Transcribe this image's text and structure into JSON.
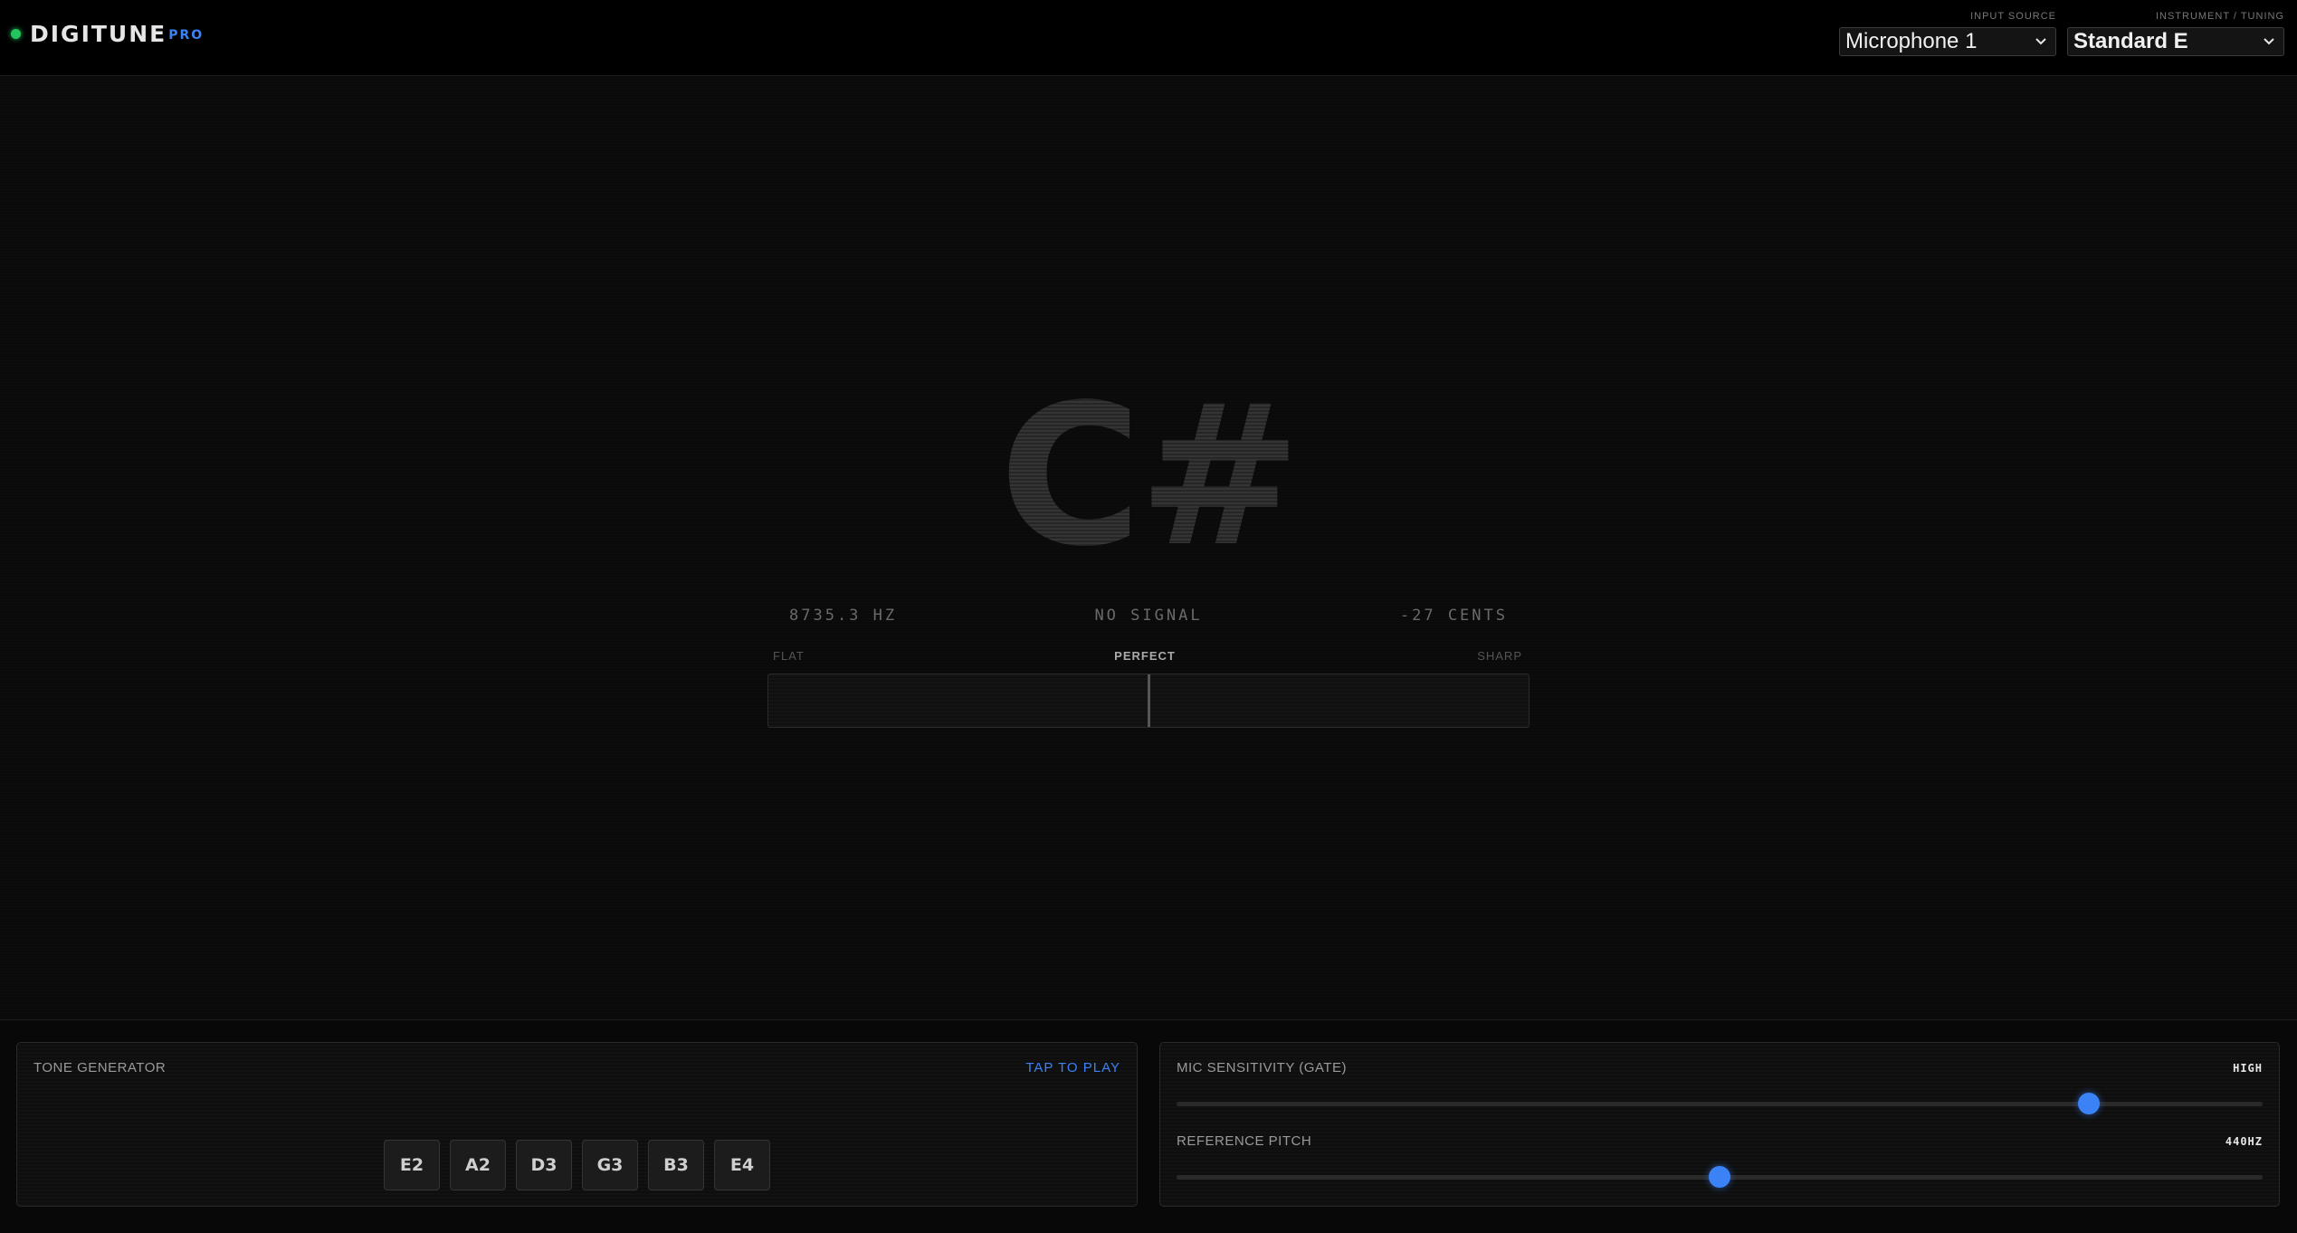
{
  "header": {
    "logo_main": "DIGITUNE",
    "logo_sub": "PRO",
    "input_source": {
      "label": "INPUT SOURCE",
      "value": "Microphone 1"
    },
    "tuning": {
      "label": "INSTRUMENT / TUNING",
      "value": "Standard E"
    }
  },
  "tuner": {
    "note": "C#",
    "frequency": "8735.3 HZ",
    "status": "NO SIGNAL",
    "cents": "-27 CENTS",
    "meter_flat": "FLAT",
    "meter_perfect": "PERFECT",
    "meter_sharp": "SHARP"
  },
  "tone_generator": {
    "title": "TONE GENERATOR",
    "action": "TAP TO PLAY",
    "notes": [
      "E2",
      "A2",
      "D3",
      "G3",
      "B3",
      "E4"
    ]
  },
  "settings": {
    "mic_sensitivity": {
      "label": "MIC SENSITIVITY (GATE)",
      "value_text": "HIGH",
      "level": 0.84
    },
    "reference_pitch": {
      "label": "REFERENCE PITCH",
      "value_text": "440HZ",
      "level": 0.5
    }
  },
  "colors": {
    "accent": "#3b82f6",
    "status_dot": "#22c55e",
    "background": "#0a0a0a"
  },
  "icons": {
    "status": "status-dot-icon",
    "dropdown": "chevron-down-icon"
  }
}
